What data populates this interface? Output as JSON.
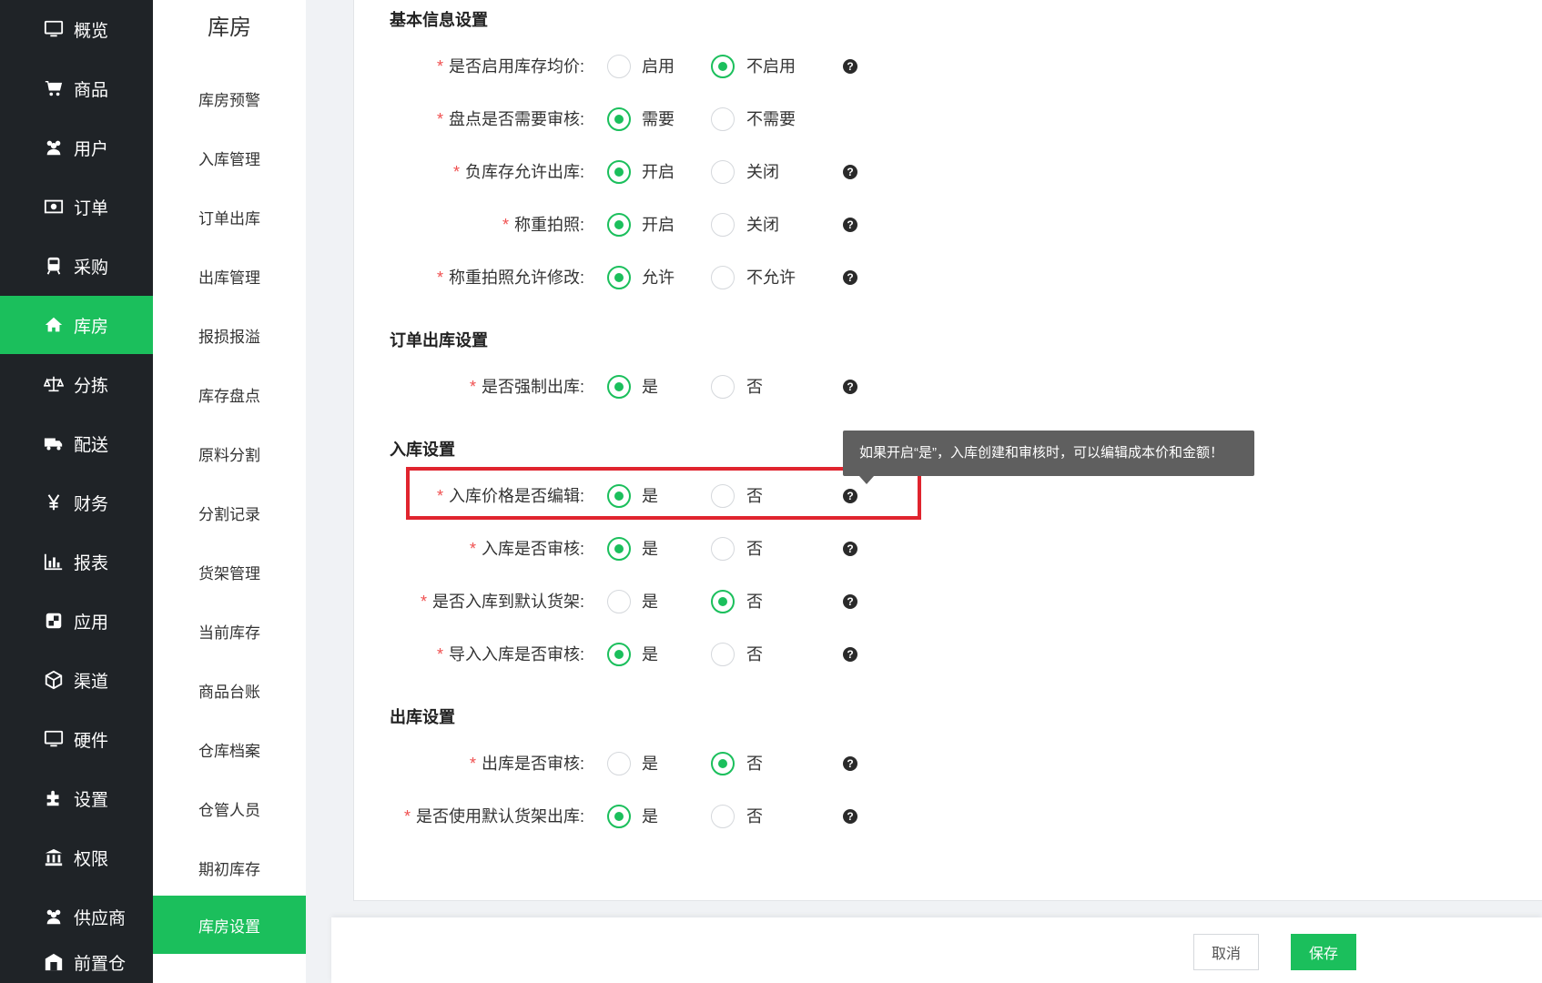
{
  "sidebar": {
    "items": [
      {
        "label": "概览",
        "icon": "monitor-icon"
      },
      {
        "label": "商品",
        "icon": "cart-icon"
      },
      {
        "label": "用户",
        "icon": "users-icon"
      },
      {
        "label": "订单",
        "icon": "money-icon"
      },
      {
        "label": "采购",
        "icon": "train-icon"
      },
      {
        "label": "库房",
        "icon": "home-icon",
        "active": true
      },
      {
        "label": "分拣",
        "icon": "scale-icon"
      },
      {
        "label": "配送",
        "icon": "truck-icon"
      },
      {
        "label": "财务",
        "icon": "yen-icon"
      },
      {
        "label": "报表",
        "icon": "bar-chart-icon"
      },
      {
        "label": "应用",
        "icon": "apps-icon"
      },
      {
        "label": "渠道",
        "icon": "cube-icon"
      },
      {
        "label": "硬件",
        "icon": "monitor-icon"
      },
      {
        "label": "设置",
        "icon": "puzzle-icon"
      },
      {
        "label": "权限",
        "icon": "bank-icon"
      },
      {
        "label": "供应商",
        "icon": "users-icon"
      },
      {
        "label": "前置仓",
        "icon": "warehouse-icon"
      }
    ]
  },
  "subnav": {
    "title": "库房",
    "items": [
      "库房预警",
      "入库管理",
      "订单出库",
      "出库管理",
      "报损报溢",
      "库存盘点",
      "原料分割",
      "分割记录",
      "货架管理",
      "当前库存",
      "商品台账",
      "仓库档案",
      "仓管人员",
      "期初库存",
      "库房设置"
    ],
    "active": "库房设置"
  },
  "sections": {
    "basic": "基本信息设置",
    "order_out": "订单出库设置",
    "inbound": "入库设置",
    "outbound": "出库设置"
  },
  "rows": {
    "avg_price": {
      "label": "是否启用库存均价:",
      "opt1": "启用",
      "opt2": "不启用",
      "selected": 2
    },
    "stocktake_audit": {
      "label": "盘点是否需要审核:",
      "opt1": "需要",
      "opt2": "不需要",
      "selected": 1
    },
    "negative_stock": {
      "label": "负库存允许出库:",
      "opt1": "开启",
      "opt2": "关闭",
      "selected": 1
    },
    "weigh_photo": {
      "label": "称重拍照:",
      "opt1": "开启",
      "opt2": "关闭",
      "selected": 1
    },
    "weigh_photo_edit": {
      "label": "称重拍照允许修改:",
      "opt1": "允许",
      "opt2": "不允许",
      "selected": 1
    },
    "force_out": {
      "label": "是否强制出库:",
      "opt1": "是",
      "opt2": "否",
      "selected": 1
    },
    "in_price_edit": {
      "label": "入库价格是否编辑:",
      "opt1": "是",
      "opt2": "否",
      "selected": 1
    },
    "in_audit": {
      "label": "入库是否审核:",
      "opt1": "是",
      "opt2": "否",
      "selected": 1
    },
    "in_default_shelf": {
      "label": "是否入库到默认货架:",
      "opt1": "是",
      "opt2": "否",
      "selected": 2
    },
    "import_in_audit": {
      "label": "导入入库是否审核:",
      "opt1": "是",
      "opt2": "否",
      "selected": 1
    },
    "out_audit": {
      "label": "出库是否审核:",
      "opt1": "是",
      "opt2": "否",
      "selected": 2
    },
    "out_default_shelf": {
      "label": "是否使用默认货架出库:",
      "opt1": "是",
      "opt2": "否",
      "selected": 1
    }
  },
  "required_mark": "*",
  "help_glyph": "?",
  "tooltip": "如果开启“是”，入库创建和审核时，可以编辑成本价和金额！",
  "footer": {
    "cancel": "取消",
    "save": "保存"
  },
  "colors": {
    "accent": "#1bbf5c",
    "sidebar_bg": "#1f2327",
    "highlight": "#e0242e",
    "required": "#f05050"
  }
}
